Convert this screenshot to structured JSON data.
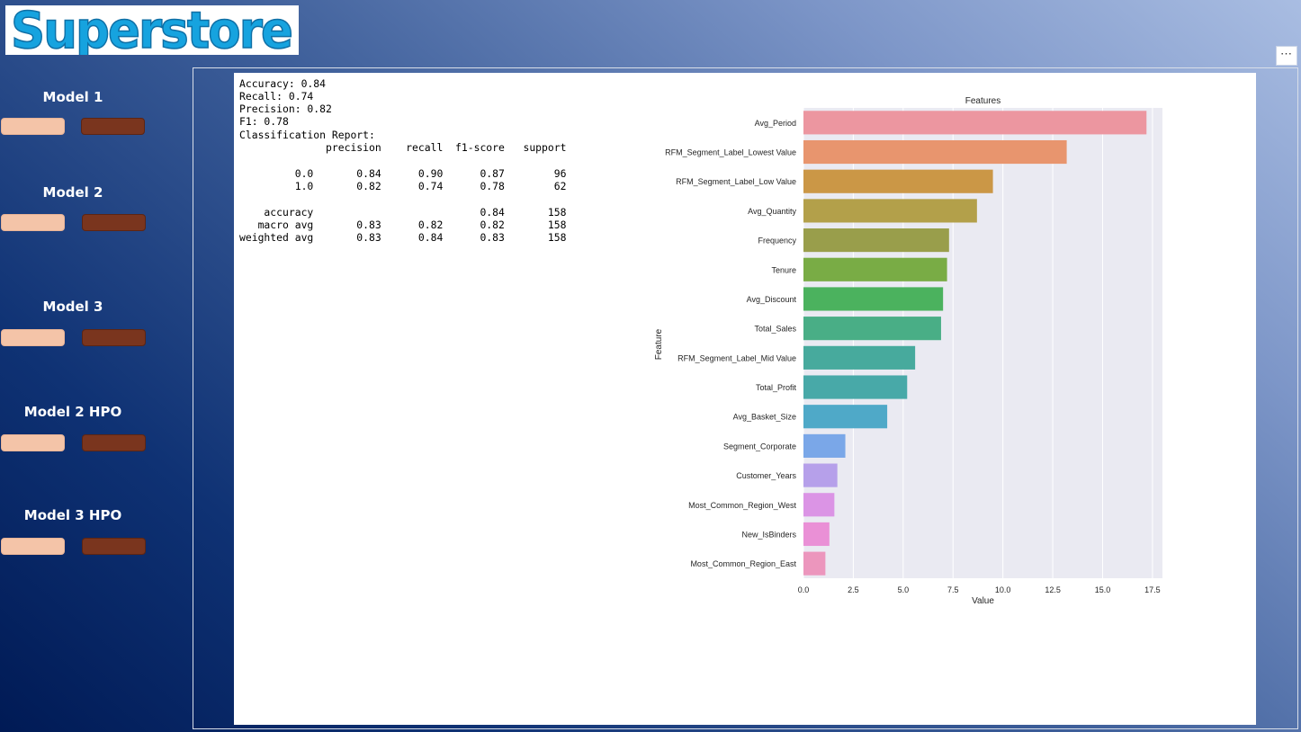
{
  "logo": {
    "text": "Superstore"
  },
  "toolbar": {
    "more_label": "⋯"
  },
  "sidebar": {
    "models": [
      {
        "title": "Model 1"
      },
      {
        "title": "Model 2"
      },
      {
        "title": "Model 3"
      },
      {
        "title": "Model 2 HPO"
      },
      {
        "title": "Model 3 HPO"
      }
    ]
  },
  "colors": {
    "button_light": "#f4c4a8",
    "button_dark": "#7a351e",
    "plot_bg": "#eaeaf2"
  },
  "report": {
    "lines": [
      "Accuracy: 0.84",
      "Recall: 0.74",
      "Precision: 0.82",
      "F1: 0.78",
      "Classification Report:",
      "              precision    recall  f1-score   support",
      "",
      "         0.0       0.84      0.90      0.87        96",
      "         1.0       0.82      0.74      0.78        62",
      "",
      "    accuracy                           0.84       158",
      "   macro avg       0.83      0.82      0.82       158",
      "weighted avg       0.83      0.84      0.83       158"
    ]
  },
  "chart_data": {
    "type": "bar",
    "orientation": "horizontal",
    "title": "Features",
    "xlabel": "Value",
    "ylabel": "Feature",
    "xlim": [
      0,
      18
    ],
    "xticks": [
      "0.0",
      "2.5",
      "5.0",
      "7.5",
      "10.0",
      "12.5",
      "15.0",
      "17.5"
    ],
    "categories": [
      "Avg_Period",
      "RFM_Segment_Label_Lowest Value",
      "RFM_Segment_Label_Low Value",
      "Avg_Quantity",
      "Frequency",
      "Tenure",
      "Avg_Discount",
      "Total_Sales",
      "RFM_Segment_Label_Mid Value",
      "Total_Profit",
      "Avg_Basket_Size",
      "Segment_Corporate",
      "Customer_Years",
      "Most_Common_Region_West",
      "New_IsBinders",
      "Most_Common_Region_East"
    ],
    "values": [
      17.2,
      13.2,
      9.5,
      8.7,
      7.3,
      7.2,
      7.0,
      6.9,
      5.6,
      5.2,
      4.2,
      2.1,
      1.7,
      1.55,
      1.3,
      1.1
    ],
    "colors": [
      "#ec96a0",
      "#e8956e",
      "#cb9746",
      "#b3a04a",
      "#999e4b",
      "#79ac45",
      "#4bb25e",
      "#49ae86",
      "#47aa9d",
      "#48a9a8",
      "#4fa9c8",
      "#7aa7e8",
      "#b6a0ea",
      "#db94e5",
      "#ea90d6",
      "#ec96bd"
    ],
    "grid": true
  }
}
